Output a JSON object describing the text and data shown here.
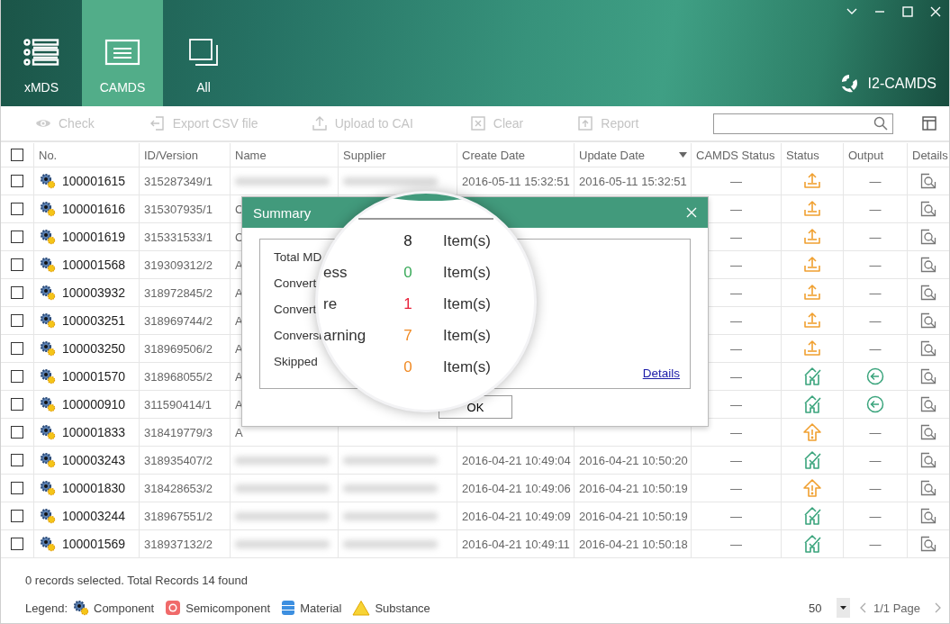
{
  "nav_tabs": [
    {
      "label": "xMDS",
      "kind": "list",
      "selected": false
    },
    {
      "label": "CAMDS",
      "kind": "form",
      "selected": true
    },
    {
      "label": "All",
      "kind": "stack",
      "selected": false
    }
  ],
  "brand": "I2-CAMDS",
  "toolbar": {
    "buttons": [
      {
        "label": "Check",
        "kind": "eye",
        "disabled": true
      },
      {
        "label": "Export CSV file",
        "kind": "export",
        "disabled": true
      },
      {
        "label": "Upload to CAI",
        "kind": "upload",
        "disabled": true
      },
      {
        "label": "Clear",
        "kind": "clear",
        "disabled": true
      },
      {
        "label": "Report",
        "kind": "report",
        "disabled": true
      }
    ]
  },
  "table": {
    "select_all": {
      "checked": false
    },
    "columns": [
      {
        "label": "No."
      },
      {
        "label": "ID/Version"
      },
      {
        "label": "Name"
      },
      {
        "label": "Supplier"
      },
      {
        "label": "Create Date"
      },
      {
        "label": "Update Date",
        "sorted": true
      },
      {
        "label": "CAMDS Status"
      },
      {
        "label": "Status"
      },
      {
        "label": "Output"
      },
      {
        "label": "Details"
      }
    ],
    "rows": [
      {
        "checked": false,
        "kind": "component",
        "no": "100001615",
        "id": "315287349/1",
        "blurred": true,
        "create_date": "2016-05-11 15:32:51",
        "update_date": "2016-05-11 15:32:51",
        "camds_status": "—",
        "status": {
          "kind": "upload"
        },
        "output": {
          "kind": "dash",
          "text": "—"
        }
      },
      {
        "checked": false,
        "kind": "component",
        "no": "100001616",
        "id": "315307935/1",
        "name": "C",
        "camds_status": "—",
        "status": {
          "kind": "upload"
        },
        "output": {
          "kind": "dash",
          "text": "—"
        }
      },
      {
        "checked": false,
        "kind": "component",
        "no": "100001619",
        "id": "315331533/1",
        "name": "C",
        "camds_status": "—",
        "status": {
          "kind": "upload"
        },
        "output": {
          "kind": "dash",
          "text": "—"
        }
      },
      {
        "checked": false,
        "kind": "component",
        "no": "100001568",
        "id": "319309312/2",
        "name": "A",
        "camds_status": "—",
        "status": {
          "kind": "upload"
        },
        "output": {
          "kind": "dash",
          "text": "—"
        }
      },
      {
        "checked": false,
        "kind": "component",
        "no": "100003932",
        "id": "318972845/2",
        "name": "A",
        "camds_status": "—",
        "status": {
          "kind": "upload"
        },
        "output": {
          "kind": "dash",
          "text": "—"
        }
      },
      {
        "checked": false,
        "kind": "component",
        "no": "100003251",
        "id": "318969744/2",
        "name": "A",
        "camds_status": "—",
        "status": {
          "kind": "upload"
        },
        "output": {
          "kind": "dash",
          "text": "—"
        }
      },
      {
        "checked": false,
        "kind": "component",
        "no": "100003250",
        "id": "318969506/2",
        "name": "A",
        "camds_status": "—",
        "status": {
          "kind": "upload"
        },
        "output": {
          "kind": "dash",
          "text": "—"
        }
      },
      {
        "checked": false,
        "kind": "component",
        "no": "100001570",
        "id": "318968055/2",
        "name": "A",
        "camds_status": "—",
        "status": {
          "kind": "done"
        },
        "output": {
          "kind": "return"
        }
      },
      {
        "checked": false,
        "kind": "component",
        "no": "100000910",
        "id": "311590414/1",
        "name": "A",
        "camds_status": "—",
        "status": {
          "kind": "done"
        },
        "output": {
          "kind": "return"
        }
      },
      {
        "checked": false,
        "kind": "component",
        "no": "100001833",
        "id": "318419779/3",
        "name": "A",
        "camds_status": "—",
        "status": {
          "kind": "alert"
        },
        "output": {
          "kind": "dash",
          "text": "—"
        }
      },
      {
        "checked": false,
        "kind": "component",
        "no": "100003243",
        "id": "318935407/2",
        "blurred": true,
        "create_date": "2016-04-21 10:49:04",
        "update_date": "2016-04-21 10:50:20",
        "camds_status": "—",
        "status": {
          "kind": "done"
        },
        "output": {
          "kind": "dash",
          "text": "—"
        }
      },
      {
        "checked": false,
        "kind": "component",
        "no": "100001830",
        "id": "318428653/2",
        "blurred": true,
        "create_date": "2016-04-21 10:49:06",
        "update_date": "2016-04-21 10:50:19",
        "camds_status": "—",
        "status": {
          "kind": "alert"
        },
        "output": {
          "kind": "dash",
          "text": "—"
        }
      },
      {
        "checked": false,
        "kind": "component",
        "no": "100003244",
        "id": "318967551/2",
        "blurred": true,
        "create_date": "2016-04-21 10:49:09",
        "update_date": "2016-04-21 10:50:19",
        "camds_status": "—",
        "status": {
          "kind": "done"
        },
        "output": {
          "kind": "dash",
          "text": "—"
        }
      },
      {
        "checked": false,
        "kind": "component",
        "no": "100001569",
        "id": "318937132/2",
        "blurred": true,
        "create_date": "2016-04-21 10:49:11",
        "update_date": "2016-04-21 10:50:18",
        "camds_status": "—",
        "status": {
          "kind": "done"
        },
        "output": {
          "kind": "dash",
          "text": "—"
        }
      }
    ]
  },
  "footer": {
    "status": "0 records selected. Total Records 14 found",
    "legend_label": "Legend:",
    "legend": [
      {
        "label": "Component",
        "kind": "component"
      },
      {
        "label": "Semicomponent",
        "kind": "semicomponent"
      },
      {
        "label": "Material",
        "kind": "material"
      },
      {
        "label": "Substance",
        "kind": "substance"
      }
    ],
    "page_size": "50",
    "page": "1/1 Page"
  },
  "dialog": {
    "title": "Summary",
    "rows": [
      {
        "label": "Total MD"
      },
      {
        "label": "Convert"
      },
      {
        "label": "Convert"
      },
      {
        "label": "Conversi"
      },
      {
        "label": "Skipped"
      }
    ],
    "details_link": "Details",
    "ok_button": "OK"
  },
  "magnifier": {
    "rows": [
      {
        "value": "8",
        "color": "#222222",
        "unit": "Item(s)"
      },
      {
        "label": "ess",
        "value": "0",
        "color": "#3aaa5a",
        "unit": "Item(s)"
      },
      {
        "label": "re",
        "value": "1",
        "color": "#e8213a",
        "unit": "Item(s)"
      },
      {
        "label": "arning",
        "value": "7",
        "color": "#f08a24",
        "unit": "Item(s)"
      },
      {
        "value": "0",
        "color": "#f08a24",
        "unit": "Item(s)"
      }
    ]
  }
}
